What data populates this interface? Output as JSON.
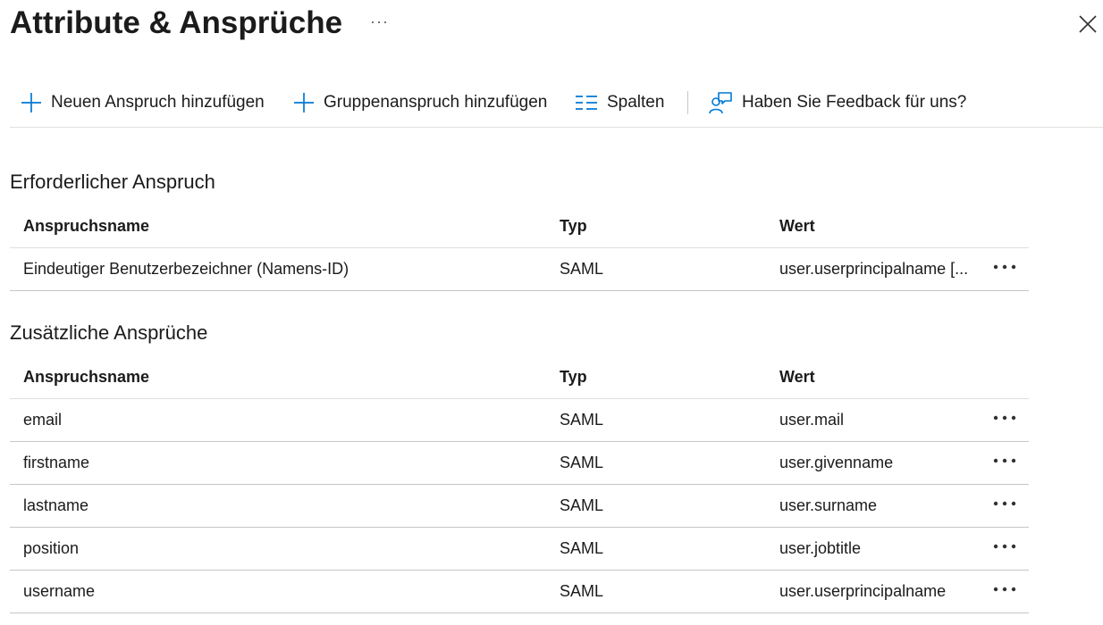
{
  "header": {
    "title": "Attribute & Ansprüche",
    "more_label": "···"
  },
  "toolbar": {
    "add_claim": "Neuen Anspruch hinzufügen",
    "add_group_claim": "Gruppenanspruch hinzufügen",
    "columns": "Spalten",
    "feedback": "Haben Sie Feedback für uns?"
  },
  "required": {
    "title": "Erforderlicher Anspruch",
    "columns": {
      "name": "Anspruchsname",
      "type": "Typ",
      "value": "Wert"
    },
    "rows": [
      {
        "name": "Eindeutiger Benutzerbezeichner (Namens-ID)",
        "type": "SAML",
        "value": "user.userprincipalname [..."
      }
    ]
  },
  "additional": {
    "title": "Zusätzliche Ansprüche",
    "columns": {
      "name": "Anspruchsname",
      "type": "Typ",
      "value": "Wert"
    },
    "rows": [
      {
        "name": "email",
        "type": "SAML",
        "value": "user.mail"
      },
      {
        "name": "firstname",
        "type": "SAML",
        "value": "user.givenname"
      },
      {
        "name": "lastname",
        "type": "SAML",
        "value": "user.surname"
      },
      {
        "name": "position",
        "type": "SAML",
        "value": "user.jobtitle"
      },
      {
        "name": "username",
        "type": "SAML",
        "value": "user.userprincipalname"
      }
    ]
  },
  "icons": {
    "add": "plus-icon",
    "columns": "columns-icon",
    "feedback": "feedback-person-icon",
    "close": "close-icon",
    "more": "more-dots-icon"
  },
  "colors": {
    "accent": "#0078d4",
    "text": "#1b1b1b",
    "divider": "#c8c6c4"
  }
}
